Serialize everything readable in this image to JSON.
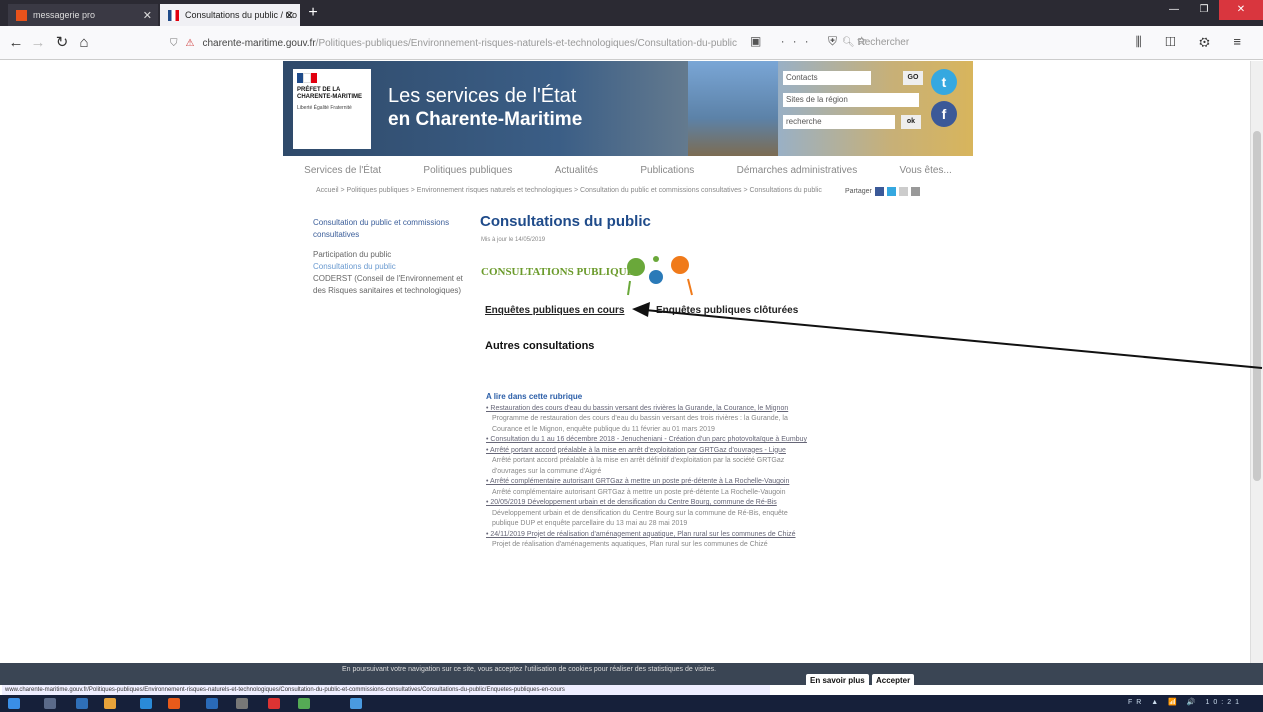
{
  "browser": {
    "tab1_title": "messagerie pro",
    "tab2_title": "Consultations du public / Co",
    "tab_close": "✕",
    "new_tab": "+",
    "url_main": "charente-maritime.gouv.fr",
    "url_rest": "/Politiques-publiques/Environnement-risques-naturels-et-technologiques/Consultation-du-public",
    "search_placeholder": "Rechercher",
    "winctl": [
      "—",
      "❐",
      "✕"
    ]
  },
  "banner": {
    "logo_title": "PRÉFET DE LA CHARENTE-MARITIME",
    "logo_motto": "Liberté Égalité Fraternité",
    "title_line1": "Les services de l'État",
    "title_line2": "en Charente-Maritime",
    "field_contacts": "Contacts",
    "field_sites": "Sites de la région",
    "field_search": "recherche",
    "ok_label": "ok",
    "go_label": "GO"
  },
  "nav": [
    "Services de l'État",
    "Politiques publiques",
    "Actualités",
    "Publications",
    "Démarches administratives",
    "Vous êtes..."
  ],
  "breadcrumb": "Accueil > Politiques publiques > Environnement risques naturels et technologiques > Consultation du public et commissions consultatives > Consultations du public",
  "share_label": "Partager",
  "sidebar": {
    "head": "Consultation du public et commissions consultatives",
    "items": [
      "Participation du public",
      "Consultations du public",
      "CODERST (Conseil de l'Environnement et des Risques sanitaires et technologiques)"
    ]
  },
  "main": {
    "title": "Consultations du public",
    "date": "Mis à jour le 14/05/2019",
    "cp_label": "CONSULTATIONS PUBLIQUES",
    "link_current": "Enquêtes publiques en cours",
    "link_closed": "Enquêtes publiques clôturées",
    "link_other": "Autres consultations"
  },
  "rubrique": {
    "title": "A lire dans cette rubrique",
    "items": [
      {
        "t": "• Restauration des cours d'eau du bassin versant des rivières la Gurande, la Courance, le Mignon",
        "d": "Programme de restauration des cours d'eau du bassin versant des trois rivières : la Gurande, la Courance et le Mignon, enquête publique du 11 février au 01 mars 2019"
      },
      {
        "t": "• Consultation du 1 au 16 décembre 2018 - Jenucheniani - Création d'un parc photovoltaïque à Eumbuy",
        "d": ""
      },
      {
        "t": "• Arrêté portant accord préalable à la mise en arrêt d'exploitation par GRTGaz d'ouvrages - Ligue",
        "d": "Arrêté portant accord préalable à la mise en arrêt définitif d'exploitation par la société GRTGaz d'ouvrages sur la commune d'Aigré"
      },
      {
        "t": "• Arrêté complémentaire autorisant GRTGaz à mettre un poste pré-détente à La Rochelle-Vaugoin",
        "d": "Arrêté complémentaire autorisant GRTGaz à mettre un poste pré-détente La Rochelle-Vaugoin"
      },
      {
        "t": "• 20/05/2019 Développement urbain et de densification du Centre Bourg, commune de Ré-Bis",
        "d": "Développement urbain et de densification du Centre Bourg sur la commune de Ré-Bis, enquête publique DUP et enquête parcellaire du 13 mai au 28 mai 2019"
      },
      {
        "t": "• 24/11/2019 Projet de réalisation d'aménagement aquatique, Plan rural sur les communes de Chizé",
        "d": "Projet de réalisation d'aménagements aquatiques, Plan rural sur les communes de Chizé"
      }
    ]
  },
  "cookie": {
    "text": "En poursuivant votre navigation sur ce site, vous acceptez l'utilisation de cookies pour réaliser des statistiques de visites.",
    "more": "En savoir plus",
    "accept": "Accepter"
  },
  "status_url": "www.charente-maritime.gouv.fr/Politiques-publiques/Environnement-risques-naturels-et-technologiques/Consultation-du-public-et-commissions-consultatives/Consultations-du-public/Enquetes-publiques-en-cours",
  "taskbar": {
    "tray": "FR ▲ 📶 🔊",
    "clock": "10:21"
  },
  "colors": {
    "accent_blue": "#1f4b8a",
    "cp_green": "#6a9a2a",
    "twitter": "#35a8e0",
    "facebook": "#3b5998"
  }
}
